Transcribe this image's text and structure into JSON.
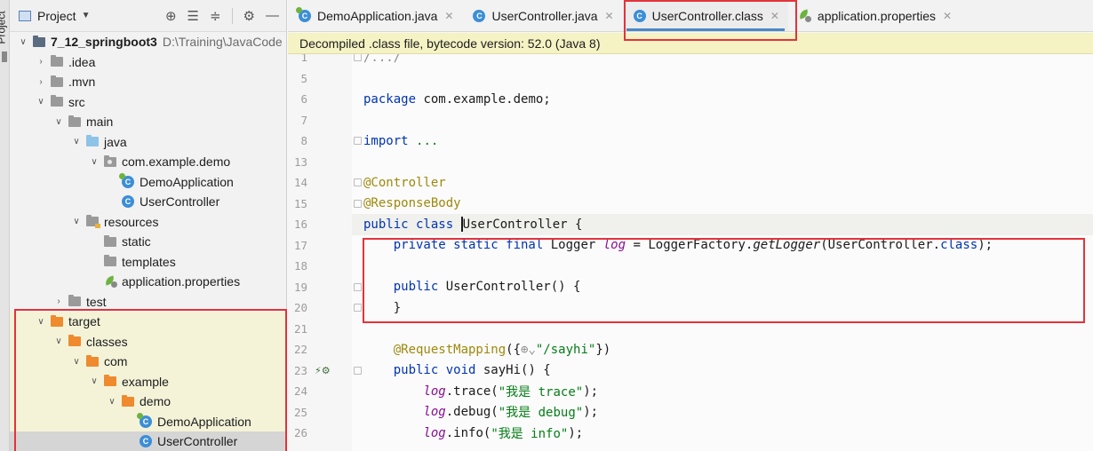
{
  "sidebar_strip": {
    "label": "Project"
  },
  "project_panel": {
    "title": "Project",
    "tools": [
      "target-icon",
      "expand-all-icon",
      "collapse-all-icon",
      "gear-icon",
      "minimize-icon"
    ],
    "tree": [
      {
        "indent": 0,
        "arrow": "down",
        "icon": "module",
        "label": "7_12_springboot3",
        "bold": true,
        "path": "D:\\Training\\JavaCode"
      },
      {
        "indent": 1,
        "arrow": "right",
        "icon": "grey",
        "label": ".idea"
      },
      {
        "indent": 1,
        "arrow": "right",
        "icon": "grey",
        "label": ".mvn"
      },
      {
        "indent": 1,
        "arrow": "down",
        "icon": "grey",
        "label": "src"
      },
      {
        "indent": 2,
        "arrow": "down",
        "icon": "grey",
        "label": "main"
      },
      {
        "indent": 3,
        "arrow": "down",
        "icon": "blue",
        "label": "java"
      },
      {
        "indent": 4,
        "arrow": "down",
        "icon": "pkg",
        "label": "com.example.demo"
      },
      {
        "indent": 5,
        "arrow": "none",
        "icon": "class-spring",
        "label": "DemoApplication"
      },
      {
        "indent": 5,
        "arrow": "none",
        "icon": "class",
        "label": "UserController"
      },
      {
        "indent": 3,
        "arrow": "down",
        "icon": "res",
        "label": "resources"
      },
      {
        "indent": 4,
        "arrow": "none",
        "icon": "grey",
        "label": "static"
      },
      {
        "indent": 4,
        "arrow": "none",
        "icon": "grey",
        "label": "templates"
      },
      {
        "indent": 4,
        "arrow": "none",
        "icon": "props",
        "label": "application.properties"
      },
      {
        "indent": 2,
        "arrow": "right",
        "icon": "grey",
        "label": "test"
      },
      {
        "indent": 1,
        "arrow": "down",
        "icon": "orange",
        "label": "target",
        "hl": true
      },
      {
        "indent": 2,
        "arrow": "down",
        "icon": "orange",
        "label": "classes",
        "hl": true
      },
      {
        "indent": 3,
        "arrow": "down",
        "icon": "orange",
        "label": "com",
        "hl": true
      },
      {
        "indent": 4,
        "arrow": "down",
        "icon": "orange",
        "label": "example",
        "hl": true
      },
      {
        "indent": 5,
        "arrow": "down",
        "icon": "orange",
        "label": "demo",
        "hl": true
      },
      {
        "indent": 6,
        "arrow": "none",
        "icon": "class-spring",
        "label": "DemoApplication",
        "hl": true
      },
      {
        "indent": 6,
        "arrow": "none",
        "icon": "class",
        "label": "UserController",
        "sel": true
      }
    ]
  },
  "tabs": [
    {
      "label": "DemoApplication.java",
      "icon": "class-spring",
      "active": false
    },
    {
      "label": "UserController.java",
      "icon": "class",
      "active": false
    },
    {
      "label": "UserController.class",
      "icon": "class",
      "active": true
    },
    {
      "label": "application.properties",
      "icon": "props",
      "active": false
    }
  ],
  "notice": "Decompiled .class file, bytecode version: 52.0 (Java 8)",
  "editor": {
    "lines": [
      {
        "num": "1",
        "fold": true,
        "tokens": [
          {
            "t": "/.../",
            "c": "cmt"
          }
        ]
      },
      {
        "num": "5",
        "tokens": []
      },
      {
        "num": "6",
        "tokens": [
          {
            "t": "package ",
            "c": "kw"
          },
          {
            "t": "com.example.demo;"
          }
        ]
      },
      {
        "num": "7",
        "tokens": []
      },
      {
        "num": "8",
        "fold": true,
        "tokens": [
          {
            "t": "import ",
            "c": "kw"
          },
          {
            "t": "...",
            "c": "str"
          }
        ]
      },
      {
        "num": "13",
        "tokens": []
      },
      {
        "num": "14",
        "fold": true,
        "tokens": [
          {
            "t": "@Controller",
            "c": "ann"
          }
        ]
      },
      {
        "num": "15",
        "fold": true,
        "tokens": [
          {
            "t": "@ResponseBody",
            "c": "ann"
          }
        ]
      },
      {
        "num": "16",
        "current": true,
        "tokens": [
          {
            "t": "public class ",
            "c": "kw"
          },
          {
            "t": "caret"
          },
          {
            "t": "UserController {"
          }
        ]
      },
      {
        "num": "17",
        "tokens": [
          {
            "t": "    "
          },
          {
            "t": "private static final ",
            "c": "kw"
          },
          {
            "t": "Logger "
          },
          {
            "t": "log",
            "c": "it"
          },
          {
            "t": " = LoggerFactory."
          },
          {
            "t": "getLogger",
            "c": "italic"
          },
          {
            "t": "(UserController."
          },
          {
            "t": "class",
            "c": "kw"
          },
          {
            "t": ");"
          }
        ]
      },
      {
        "num": "18",
        "tokens": []
      },
      {
        "num": "19",
        "fold": true,
        "tokens": [
          {
            "t": "    "
          },
          {
            "t": "public ",
            "c": "kw"
          },
          {
            "t": "UserController() {"
          }
        ]
      },
      {
        "num": "20",
        "fold": true,
        "tokens": [
          {
            "t": "    }"
          }
        ]
      },
      {
        "num": "21",
        "tokens": []
      },
      {
        "num": "22",
        "tokens": [
          {
            "t": "    "
          },
          {
            "t": "@RequestMapping",
            "c": "ann"
          },
          {
            "t": "({"
          },
          {
            "t": "⊕⌄",
            "c": "cmt"
          },
          {
            "t": "\"/sayhi\"",
            "c": "str"
          },
          {
            "t": "})"
          }
        ]
      },
      {
        "num": "23",
        "fold": true,
        "run": true,
        "tokens": [
          {
            "t": "    "
          },
          {
            "t": "public void ",
            "c": "kw"
          },
          {
            "t": "sayHi() {"
          }
        ]
      },
      {
        "num": "24",
        "tokens": [
          {
            "t": "        "
          },
          {
            "t": "log",
            "c": "it"
          },
          {
            "t": ".trace("
          },
          {
            "t": "\"我是 trace\"",
            "c": "str"
          },
          {
            "t": ");"
          }
        ]
      },
      {
        "num": "25",
        "tokens": [
          {
            "t": "        "
          },
          {
            "t": "log",
            "c": "it"
          },
          {
            "t": ".debug("
          },
          {
            "t": "\"我是 debug\"",
            "c": "str"
          },
          {
            "t": ");"
          }
        ]
      },
      {
        "num": "26",
        "tokens": [
          {
            "t": "        "
          },
          {
            "t": "log",
            "c": "it"
          },
          {
            "t": ".info("
          },
          {
            "t": "\"我是 info\"",
            "c": "str"
          },
          {
            "t": ");"
          }
        ]
      }
    ]
  },
  "colors": {
    "highlight_box": "#e2333a",
    "tab_underline": "#4a88c7",
    "notice_bg": "#f5f2c4"
  }
}
